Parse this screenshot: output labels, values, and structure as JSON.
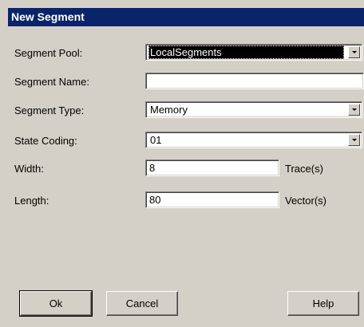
{
  "window": {
    "title": "New Segment"
  },
  "form": {
    "segment_pool": {
      "label": "Segment Pool:",
      "value": "LocalSegments"
    },
    "segment_name": {
      "label": "Segment Name:",
      "value": ""
    },
    "segment_type": {
      "label": "Segment Type:",
      "value": "Memory"
    },
    "state_coding": {
      "label": "State Coding:",
      "value": "01"
    },
    "width": {
      "label": "Width:",
      "value": "8",
      "unit": "Trace(s)"
    },
    "length": {
      "label": "Length:",
      "value": "80",
      "unit": "Vector(s)"
    }
  },
  "buttons": {
    "ok": "Ok",
    "cancel": "Cancel",
    "help": "Help"
  },
  "colors": {
    "titlebar": "#0a246a",
    "face": "#d4d0c8"
  },
  "icons": [
    "dropdown-arrow-icon"
  ]
}
